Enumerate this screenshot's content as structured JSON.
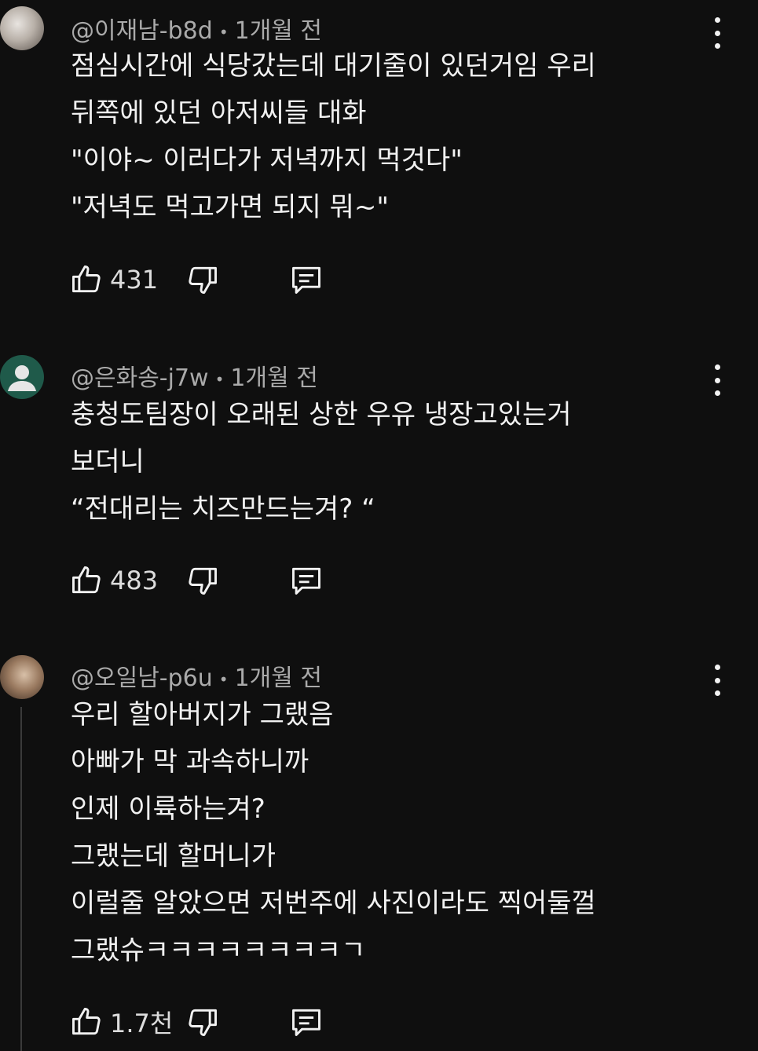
{
  "comments": [
    {
      "handle": "@이재남-b8d",
      "time": "1개월 전",
      "lines": [
        "점심시간에 식당갔는데 대기줄이 있던거임 우리",
        "뒤쪽에 있던 아저씨들 대화",
        "\"이야~ 이러다가 저녁까지 먹것다\"",
        "\"저녁도 먹고가면 되지 뭐~\""
      ],
      "likes": "431"
    },
    {
      "handle": "@은화송-j7w",
      "time": "1개월 전",
      "lines": [
        "충청도팀장이 오래된 상한 우유 냉장고있는거",
        "보더니",
        "“전대리는 치즈만드는겨? “"
      ],
      "likes": "483"
    },
    {
      "handle": "@오일남-p6u",
      "time": "1개월 전",
      "lines": [
        "우리 할아버지가 그랬음",
        "아빠가 막 과속하니까",
        "인제 이륙하는겨?",
        "그랬는데 할머니가",
        "이럴줄 알았으면 저번주에 사진이라도 찍어둘껄",
        "그랬슈ㅋㅋㅋㅋㅋㅋㅋㅋㄱ"
      ],
      "likes": "1.7천"
    }
  ],
  "separator": "•",
  "icons": {
    "like": "thumbs-up-icon",
    "dislike": "thumbs-down-icon",
    "reply": "reply-comment-icon",
    "more": "more-vertical-icon"
  },
  "colors": {
    "background": "#0f0f0f",
    "text": "#f1f1f1",
    "meta": "#aaaaaa"
  }
}
